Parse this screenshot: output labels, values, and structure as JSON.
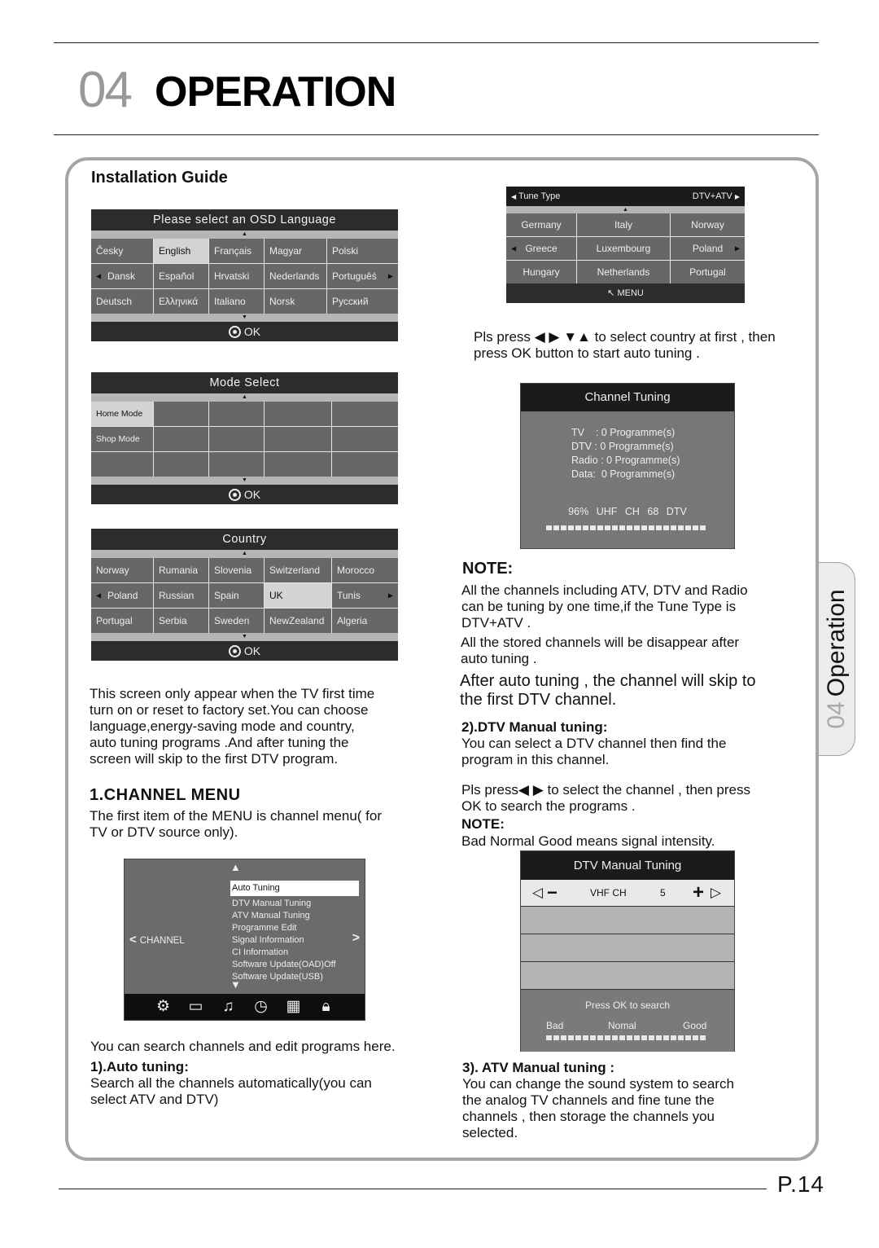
{
  "header": {
    "chapter_number": "04",
    "chapter_title": "OPERATION"
  },
  "side_tab": {
    "number": "04",
    "label": "Operation"
  },
  "page_number": "P.14",
  "left": {
    "section_title": "Installation Guide",
    "osd_language": {
      "title": "Please select an OSD Language",
      "rows": [
        [
          "Česky",
          "English",
          "Français",
          "Magyar",
          "Polski"
        ],
        [
          "Dansk",
          "Español",
          "Hrvatski",
          "Nederlands",
          "Portuguêś"
        ],
        [
          "Deutsch",
          "Ελληνικά",
          "Italiano",
          "Norsk",
          "Русский"
        ]
      ],
      "selected": "English",
      "ok_label": "OK"
    },
    "mode_select": {
      "title": "Mode Select",
      "items": [
        "Home Mode",
        "Shop Mode"
      ],
      "selected": "Home Mode",
      "ok_label": "OK"
    },
    "country": {
      "title": "Country",
      "rows": [
        [
          "Norway",
          "Rumania",
          "Slovenia",
          "Switzerland",
          "Morocco"
        ],
        [
          "Poland",
          "Russian",
          "Spain",
          "UK",
          "Tunis"
        ],
        [
          "Portugal",
          "Serbia",
          "Sweden",
          "NewZealand",
          "Algeria"
        ]
      ],
      "selected": "UK",
      "ok_label": "OK"
    },
    "intro_text": "This screen only appear when the TV first time\nturn on or reset to factory set.You can choose\nlanguage,energy-saving mode  and country,\nauto tuning programs .And after tuning the\nscreen will  skip to the first  DTV program.",
    "channel_menu_heading": "1.CHANNEL MENU",
    "channel_menu_text": "The first item of the MENU is channel menu( for\nTV or DTV source only).",
    "channel_menu_osd": {
      "category": "CHANNEL",
      "items": [
        "Auto Tuning",
        "DTV Manual Tuning",
        "ATV Manual Tuning",
        "Programme Edit",
        "Signal Information",
        "CI Information",
        "Software Update(OAD)Off",
        "Software Update(USB)"
      ],
      "selected": "Auto Tuning",
      "bottom_icons": [
        "gear-icon",
        "monitor-icon",
        "music-note-icon",
        "clock-icon",
        "grid-icon",
        "lock-icon"
      ]
    },
    "search_text": "You can search  channels and edit programs  here.",
    "auto_tuning_heading": "1).Auto tuning:",
    "auto_tuning_text": "Search all the channels automatically(you can\nselect ATV and DTV)"
  },
  "right": {
    "tune_type_osd": {
      "label": "Tune Type",
      "value": "DTV+ATV",
      "rows": [
        [
          "Germany",
          "Italy",
          "Norway"
        ],
        [
          "Greece",
          "Luxembourg",
          "Poland"
        ],
        [
          "Hungary",
          "Netherlands",
          "Portugal"
        ]
      ],
      "menu_label": "MENU"
    },
    "press_text": "Pls press ◀ ▶ ▼▲ to select  country at first , then\npress OK button to start auto tuning .",
    "channel_tuning_osd": {
      "title": "Channel Tuning",
      "lines": [
        "TV    : 0 Programme(s)",
        "DTV : 0 Programme(s)",
        "Radio : 0 Programme(s)",
        "Data:  0 Programme(s)"
      ],
      "progress_percent": 96,
      "progress_label": "96%",
      "band": "UHF",
      "ch_label": "CH",
      "channel": "68 DTV"
    },
    "note_heading": "NOTE:",
    "note_text_1": "All the channels including ATV,  DTV and Radio\ncan be tuning by one time,if the Tune Type is\nDTV+ATV .",
    "note_text_2": "All the stored channels will be disappear after\nauto tuning .",
    "note_text_3": "After auto tuning , the channel will skip to\nthe first DTV channel.",
    "dtv_heading": "2).DTV Manual tuning:",
    "dtv_text": "You can select a DTV channel then  find the\nprogram in this channel.",
    "dtv_press_text": "Pls press◀ ▶ to select the channel , then press\nOK to search the programs .",
    "note2_heading": "NOTE:",
    "note2_text": "Bad Normal Good means signal intensity.",
    "dtv_manual_osd": {
      "title": "DTV Manual Tuning",
      "band_label": "VHF CH",
      "channel": "5",
      "press_label": "Press OK to search",
      "signal_labels": [
        "Bad",
        "Nomal",
        "Good"
      ]
    },
    "atv_heading": "3). ATV  Manual tuning :",
    "atv_text": "You can change the sound system to search\nthe analog TV channels and fine tune the\nchannels , then storage the channels you\nselected."
  }
}
